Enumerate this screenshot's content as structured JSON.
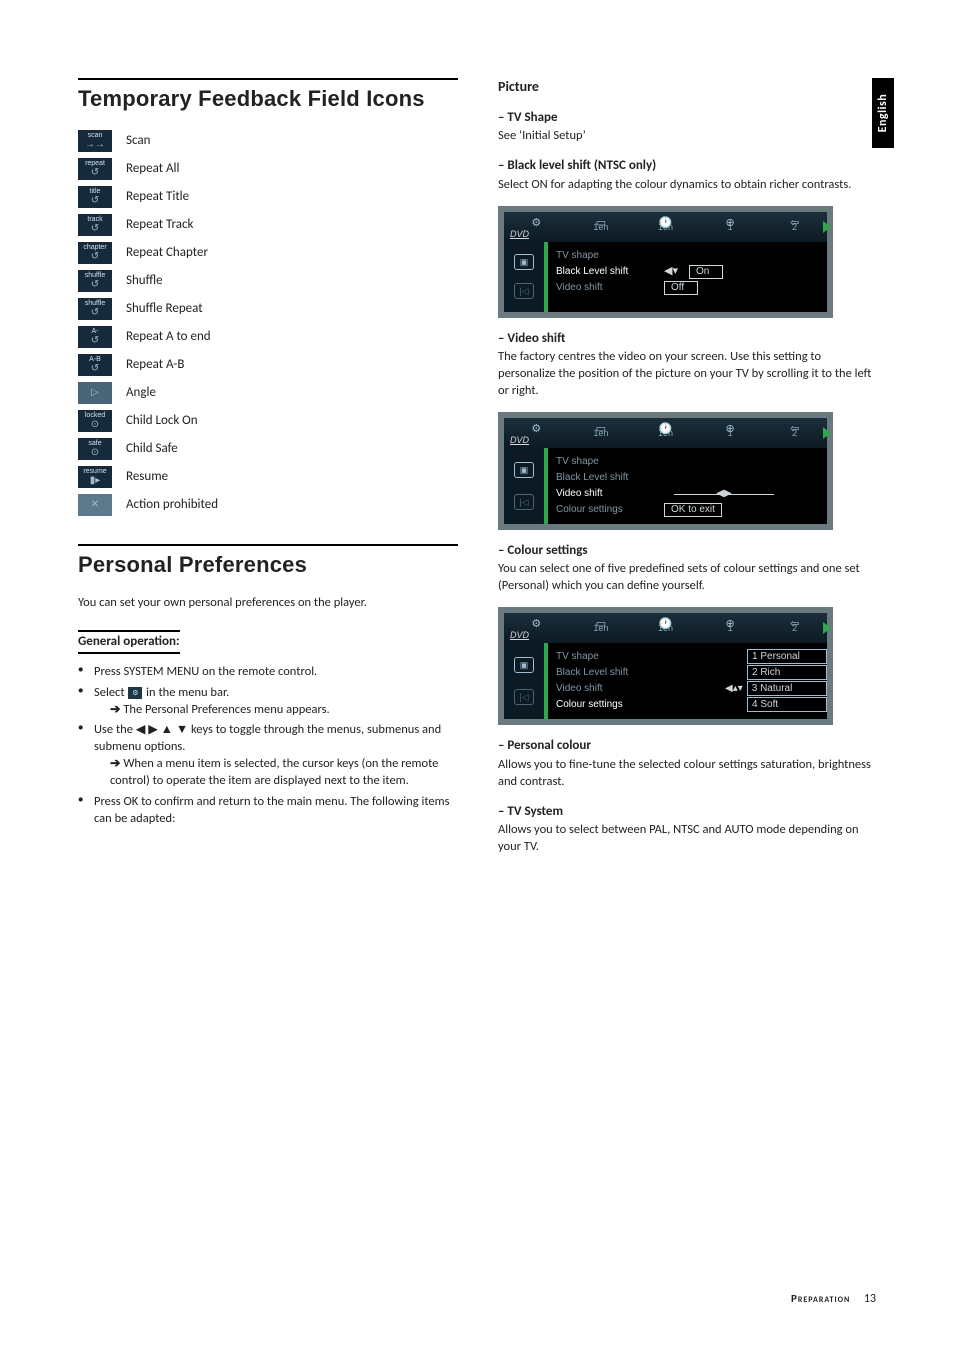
{
  "lang_tab": "English",
  "footer": {
    "section": "Preparation",
    "page": "13"
  },
  "left": {
    "h1": "Temporary Feedback Field Icons",
    "icons": [
      {
        "thumb": "scan",
        "glyph": "→→",
        "label": "Scan"
      },
      {
        "thumb": "repeat",
        "glyph": "↺",
        "label": "Repeat All"
      },
      {
        "thumb": "title",
        "glyph": "↺",
        "label": "Repeat Title"
      },
      {
        "thumb": "track",
        "glyph": "↺",
        "label": "Repeat Track"
      },
      {
        "thumb": "chapter",
        "glyph": "↺",
        "label": "Repeat Chapter"
      },
      {
        "thumb": "shuffle",
        "glyph": "↺",
        "label": "Shuffle"
      },
      {
        "thumb": "shuffle",
        "glyph": "↺",
        "label": "Shuffle Repeat"
      },
      {
        "thumb": "A-",
        "glyph": "↺",
        "label": "Repeat A to end"
      },
      {
        "thumb": "A-B",
        "glyph": "↺",
        "label": "Repeat A-B"
      },
      {
        "thumb": "",
        "glyph": "▷",
        "label": "Angle",
        "variant": "angle"
      },
      {
        "thumb": "locked",
        "glyph": "⊙",
        "label": "Child Lock On"
      },
      {
        "thumb": "safe",
        "glyph": "⊙",
        "label": "Child Safe"
      },
      {
        "thumb": "resume",
        "glyph": "▮▸",
        "label": "Resume"
      },
      {
        "thumb": "",
        "glyph": "✕",
        "label": "Action prohibited",
        "variant": "action"
      }
    ],
    "h1b": "Personal Preferences",
    "intro": "You can set your own personal preferences on the player.",
    "gen_op_head": "General operation:",
    "steps": {
      "s1": "Press SYSTEM MENU on the remote control.",
      "s2a": "Select ",
      "s2b": " in the menu bar.",
      "s2_icon": "⚙",
      "s2_sub": "The Personal Preferences menu appears.",
      "s3": "Use the ◀ ▶ ▲ ▼ keys to toggle through the menus, submenus and submenu options.",
      "s3_sub": "When a menu item is selected, the cursor keys (on the remote control) to operate the item are displayed next to the item.",
      "s4": "Press OK to confirm and return to the main menu. The following items can be adapted:"
    }
  },
  "right": {
    "h2": "Picture",
    "tv_shape": {
      "head": "TV Shape",
      "body": "See ‘Initial Setup’"
    },
    "black_level": {
      "head": "Black level shift (NTSC only)",
      "body": "Select ON for adapting the colour dynamics to obtain richer contrasts."
    },
    "video_shift": {
      "head": "Video shift",
      "body": "The factory centres the video on your screen. Use this setting to personalize the position of the picture on your TV by scrolling it to the left or right."
    },
    "colour_settings": {
      "head": "Colour settings",
      "body": "You can select one of five predefined sets of colour settings and one set (Personal) which you can define yourself."
    },
    "personal_colour": {
      "head": "Personal colour",
      "body": "Allows you to fine-tune the selected colour settings saturation, brightness and contrast."
    },
    "tv_system": {
      "head": "TV System",
      "body": "Allows you to select between PAL, NTSC and AUTO mode depending on your TV."
    },
    "osd_common": {
      "dvd": "DVD",
      "top_icons": [
        "⚙",
        "▭",
        "🕐",
        "⊕",
        "⇦"
      ],
      "top_labels": [
        "",
        "1en",
        "1en",
        "1",
        "2"
      ],
      "side_icon_top": "▣",
      "side_icon_bot": "|◁"
    },
    "osd1": {
      "rows": [
        {
          "label": "TV shape",
          "hl": false
        },
        {
          "label": "Black Level shift",
          "hl": true,
          "ctrl": "◀▾",
          "val": "On"
        },
        {
          "label": "Video shift",
          "hl": false,
          "val": "Off"
        }
      ]
    },
    "osd2": {
      "rows": [
        {
          "label": "TV shape"
        },
        {
          "label": "Black Level shift"
        },
        {
          "label": "Video shift",
          "hl": true,
          "slider": true
        },
        {
          "label": "Colour settings",
          "okexit": "OK to exit"
        }
      ]
    },
    "osd3": {
      "rows": [
        {
          "label": "TV shape"
        },
        {
          "label": "Black Level shift"
        },
        {
          "label": "Video shift"
        },
        {
          "label": "Colour settings",
          "hl": true
        }
      ],
      "list": [
        {
          "text": "1 Personal"
        },
        {
          "text": "2 Rich"
        },
        {
          "text": "3 Natural",
          "ctrl": "◀▴▾"
        },
        {
          "text": "4 Soft"
        }
      ]
    }
  }
}
